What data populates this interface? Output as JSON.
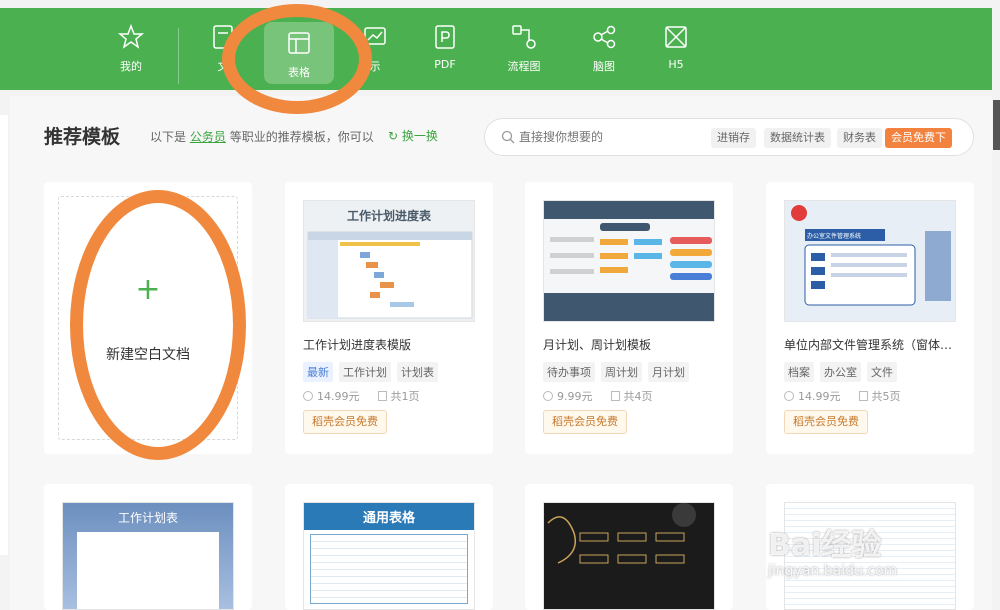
{
  "nav": {
    "items": [
      {
        "label": "我的",
        "icon": "star-icon"
      },
      {
        "label": "文",
        "icon": "document-icon"
      },
      {
        "label": "表格",
        "icon": "table-icon"
      },
      {
        "label": "示",
        "icon": "presentation-icon"
      },
      {
        "label": "PDF",
        "icon": "pdf-icon"
      },
      {
        "label": "流程图",
        "icon": "flowchart-icon"
      },
      {
        "label": "脑图",
        "icon": "mindmap-icon"
      },
      {
        "label": "H5",
        "icon": "h5-icon"
      }
    ],
    "active": "表格"
  },
  "header": {
    "title": "推荐模板",
    "sub_prefix": "以下是",
    "sub_link": "公务员",
    "sub_suffix": "等职业的推荐模板，你可以",
    "refresh": "换一换"
  },
  "search": {
    "placeholder": "直接搜你想要的",
    "tags": [
      "进销存",
      "数据统计表",
      "财务表",
      "会员免费下"
    ]
  },
  "new_blank": {
    "plus": "+",
    "label": "新建空白文档"
  },
  "templates": [
    {
      "name": "工作计划进度表模版",
      "tags": [
        "最新",
        "工作计划",
        "计划表"
      ],
      "price": "14.99元",
      "pages": "共1页",
      "member": "稻壳会员免费",
      "thumb_title": "工作计划进度表"
    },
    {
      "name": "月计划、周计划模板",
      "tags": [
        "待办事项",
        "周计划",
        "月计划"
      ],
      "price": "9.99元",
      "pages": "共4页",
      "member": "稻壳会员免费",
      "thumb_title": ""
    },
    {
      "name": "单位内部文件管理系统（窗体…",
      "tags": [
        "档案",
        "办公室",
        "文件"
      ],
      "price": "14.99元",
      "pages": "共5页",
      "member": "稻壳会员免费",
      "thumb_title": "办公室文件管理系统"
    }
  ],
  "row2": [
    {
      "thumb_title": "工作计划表"
    },
    {
      "thumb_title": "通用表格"
    },
    {
      "thumb_title": ""
    },
    {
      "thumb_title": ""
    }
  ],
  "watermark": {
    "main": "Bai经验",
    "sub": "jingyan.baidu.com"
  }
}
